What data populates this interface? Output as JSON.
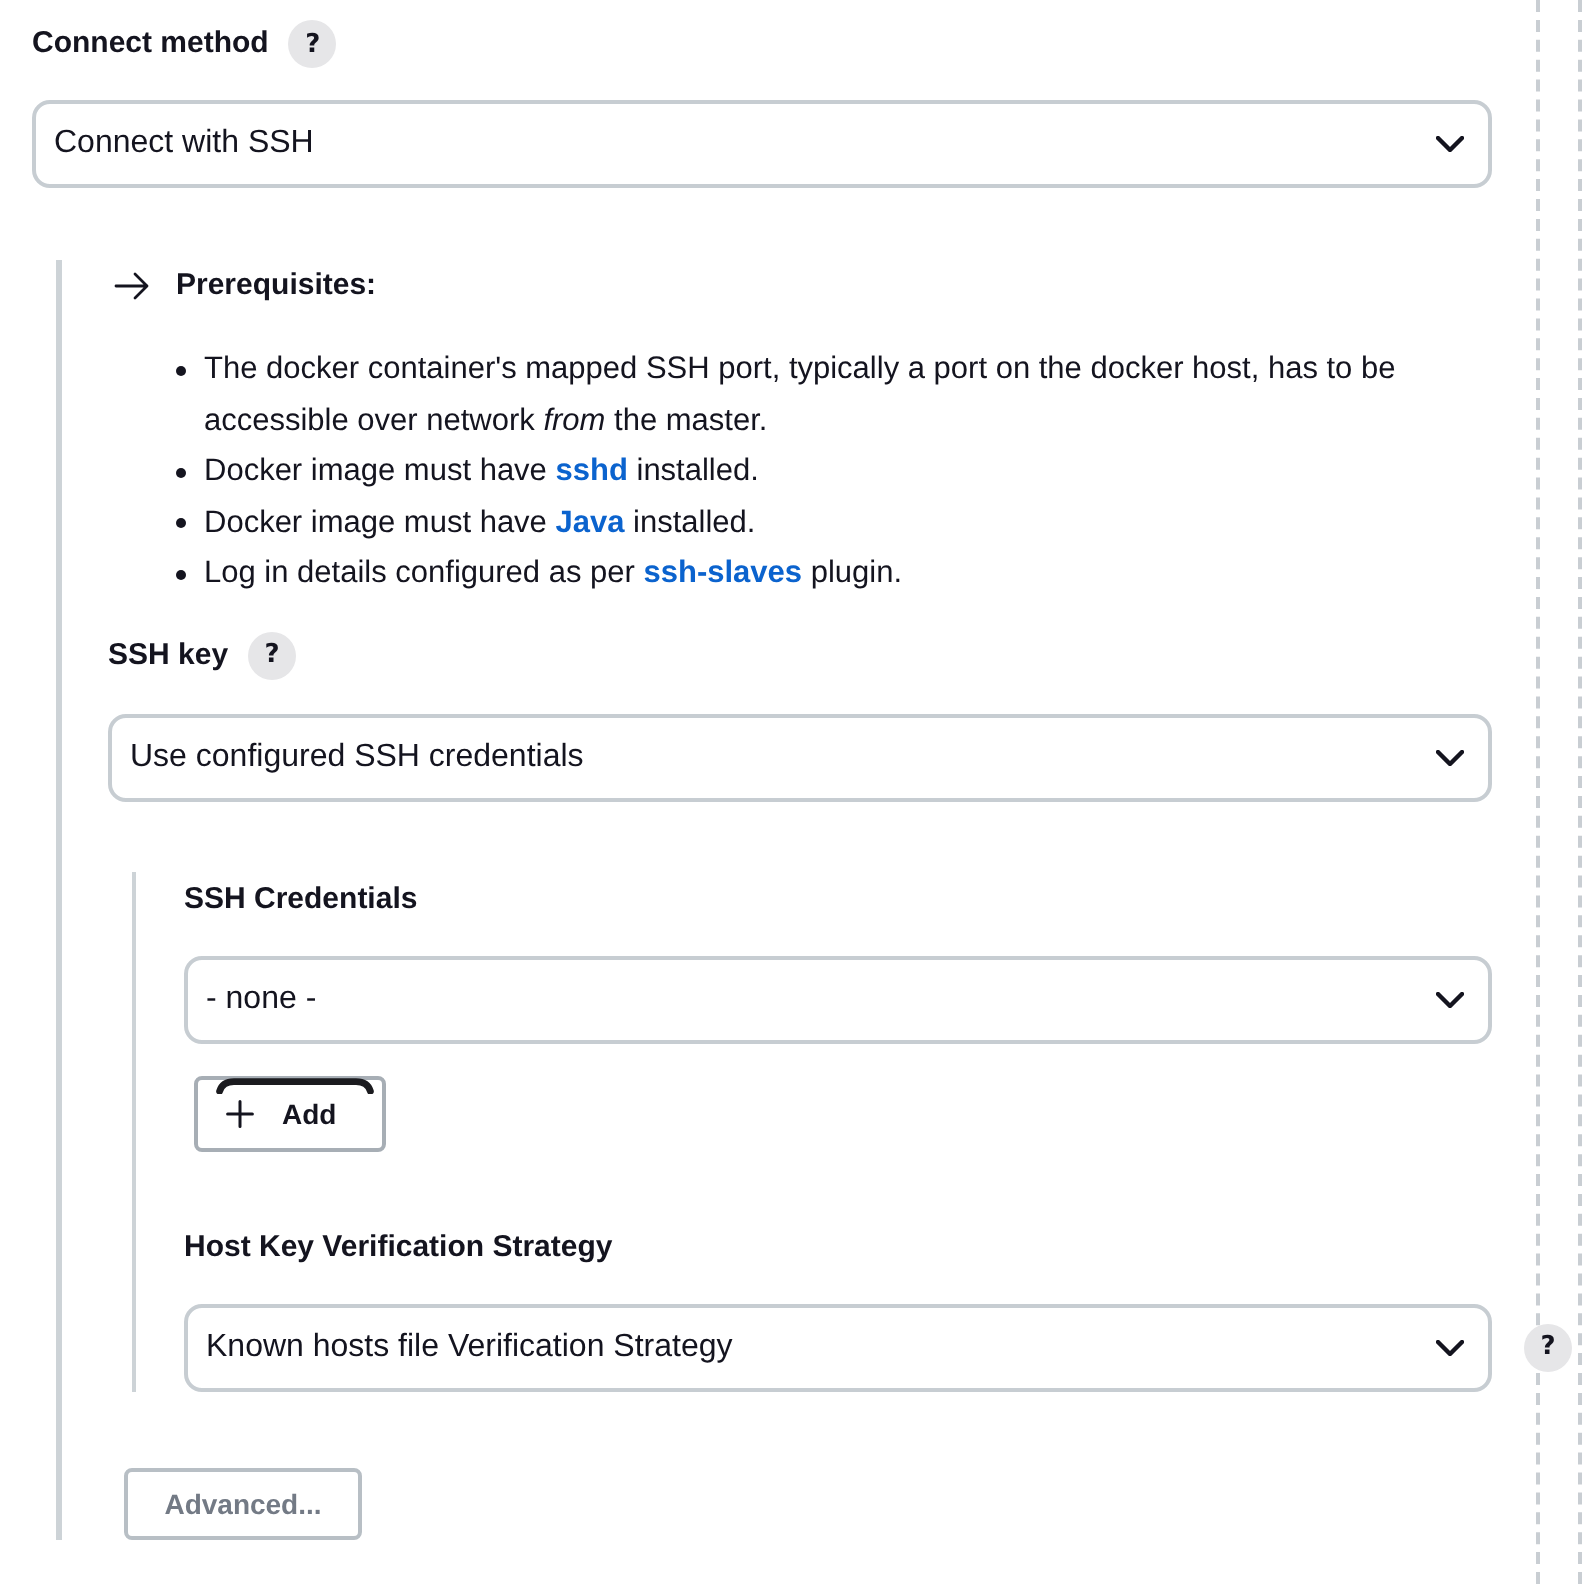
{
  "connect_method": {
    "label": "Connect method",
    "help": "?",
    "select": {
      "value": "Connect with SSH"
    }
  },
  "launcher": {
    "prerequisites": {
      "title": "Prerequisites:",
      "items": [
        [
          {
            "kind": "text",
            "text": "The docker container's mapped SSH port, typically a port on the docker host, has to be accessible over network *from* the master."
          }
        ],
        [
          {
            "kind": "text",
            "text": "Docker image must have "
          },
          {
            "kind": "link",
            "text": "sshd"
          },
          {
            "kind": "text",
            "text": " installed."
          }
        ],
        [
          {
            "kind": "text",
            "text": "Docker image must have "
          },
          {
            "kind": "link",
            "text": "Java"
          },
          {
            "kind": "text",
            "text": " installed."
          }
        ],
        [
          {
            "kind": "text",
            "text": "Log in details configured as per "
          },
          {
            "kind": "link",
            "text": "ssh-slaves"
          },
          {
            "kind": "text",
            "text": " plugin."
          }
        ]
      ]
    },
    "ssh_key": {
      "label": "SSH key",
      "help": "?",
      "select": {
        "value": "Use configured SSH credentials"
      },
      "ssh_credentials": {
        "label": "SSH Credentials",
        "select": {
          "value": "- none -"
        },
        "add_button": {
          "label": "Add"
        }
      },
      "host_key_verification": {
        "label": "Host Key Verification Strategy",
        "select": {
          "value": "Known hosts file Verification Strategy"
        },
        "help": "?"
      }
    },
    "advanced_button": {
      "label": "Advanced..."
    }
  }
}
